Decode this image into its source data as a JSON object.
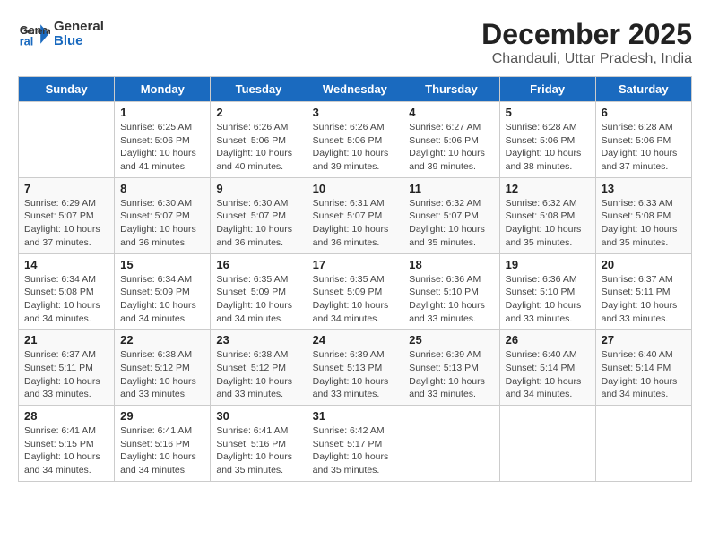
{
  "header": {
    "logo_line1": "General",
    "logo_line2": "Blue",
    "title": "December 2025",
    "subtitle": "Chandauli, Uttar Pradesh, India"
  },
  "columns": [
    "Sunday",
    "Monday",
    "Tuesday",
    "Wednesday",
    "Thursday",
    "Friday",
    "Saturday"
  ],
  "weeks": [
    [
      {
        "day": "",
        "info": ""
      },
      {
        "day": "1",
        "info": "Sunrise: 6:25 AM\nSunset: 5:06 PM\nDaylight: 10 hours\nand 41 minutes."
      },
      {
        "day": "2",
        "info": "Sunrise: 6:26 AM\nSunset: 5:06 PM\nDaylight: 10 hours\nand 40 minutes."
      },
      {
        "day": "3",
        "info": "Sunrise: 6:26 AM\nSunset: 5:06 PM\nDaylight: 10 hours\nand 39 minutes."
      },
      {
        "day": "4",
        "info": "Sunrise: 6:27 AM\nSunset: 5:06 PM\nDaylight: 10 hours\nand 39 minutes."
      },
      {
        "day": "5",
        "info": "Sunrise: 6:28 AM\nSunset: 5:06 PM\nDaylight: 10 hours\nand 38 minutes."
      },
      {
        "day": "6",
        "info": "Sunrise: 6:28 AM\nSunset: 5:06 PM\nDaylight: 10 hours\nand 37 minutes."
      }
    ],
    [
      {
        "day": "7",
        "info": "Sunrise: 6:29 AM\nSunset: 5:07 PM\nDaylight: 10 hours\nand 37 minutes."
      },
      {
        "day": "8",
        "info": "Sunrise: 6:30 AM\nSunset: 5:07 PM\nDaylight: 10 hours\nand 36 minutes."
      },
      {
        "day": "9",
        "info": "Sunrise: 6:30 AM\nSunset: 5:07 PM\nDaylight: 10 hours\nand 36 minutes."
      },
      {
        "day": "10",
        "info": "Sunrise: 6:31 AM\nSunset: 5:07 PM\nDaylight: 10 hours\nand 36 minutes."
      },
      {
        "day": "11",
        "info": "Sunrise: 6:32 AM\nSunset: 5:07 PM\nDaylight: 10 hours\nand 35 minutes."
      },
      {
        "day": "12",
        "info": "Sunrise: 6:32 AM\nSunset: 5:08 PM\nDaylight: 10 hours\nand 35 minutes."
      },
      {
        "day": "13",
        "info": "Sunrise: 6:33 AM\nSunset: 5:08 PM\nDaylight: 10 hours\nand 35 minutes."
      }
    ],
    [
      {
        "day": "14",
        "info": "Sunrise: 6:34 AM\nSunset: 5:08 PM\nDaylight: 10 hours\nand 34 minutes."
      },
      {
        "day": "15",
        "info": "Sunrise: 6:34 AM\nSunset: 5:09 PM\nDaylight: 10 hours\nand 34 minutes."
      },
      {
        "day": "16",
        "info": "Sunrise: 6:35 AM\nSunset: 5:09 PM\nDaylight: 10 hours\nand 34 minutes."
      },
      {
        "day": "17",
        "info": "Sunrise: 6:35 AM\nSunset: 5:09 PM\nDaylight: 10 hours\nand 34 minutes."
      },
      {
        "day": "18",
        "info": "Sunrise: 6:36 AM\nSunset: 5:10 PM\nDaylight: 10 hours\nand 33 minutes."
      },
      {
        "day": "19",
        "info": "Sunrise: 6:36 AM\nSunset: 5:10 PM\nDaylight: 10 hours\nand 33 minutes."
      },
      {
        "day": "20",
        "info": "Sunrise: 6:37 AM\nSunset: 5:11 PM\nDaylight: 10 hours\nand 33 minutes."
      }
    ],
    [
      {
        "day": "21",
        "info": "Sunrise: 6:37 AM\nSunset: 5:11 PM\nDaylight: 10 hours\nand 33 minutes."
      },
      {
        "day": "22",
        "info": "Sunrise: 6:38 AM\nSunset: 5:12 PM\nDaylight: 10 hours\nand 33 minutes."
      },
      {
        "day": "23",
        "info": "Sunrise: 6:38 AM\nSunset: 5:12 PM\nDaylight: 10 hours\nand 33 minutes."
      },
      {
        "day": "24",
        "info": "Sunrise: 6:39 AM\nSunset: 5:13 PM\nDaylight: 10 hours\nand 33 minutes."
      },
      {
        "day": "25",
        "info": "Sunrise: 6:39 AM\nSunset: 5:13 PM\nDaylight: 10 hours\nand 33 minutes."
      },
      {
        "day": "26",
        "info": "Sunrise: 6:40 AM\nSunset: 5:14 PM\nDaylight: 10 hours\nand 34 minutes."
      },
      {
        "day": "27",
        "info": "Sunrise: 6:40 AM\nSunset: 5:14 PM\nDaylight: 10 hours\nand 34 minutes."
      }
    ],
    [
      {
        "day": "28",
        "info": "Sunrise: 6:41 AM\nSunset: 5:15 PM\nDaylight: 10 hours\nand 34 minutes."
      },
      {
        "day": "29",
        "info": "Sunrise: 6:41 AM\nSunset: 5:16 PM\nDaylight: 10 hours\nand 34 minutes."
      },
      {
        "day": "30",
        "info": "Sunrise: 6:41 AM\nSunset: 5:16 PM\nDaylight: 10 hours\nand 35 minutes."
      },
      {
        "day": "31",
        "info": "Sunrise: 6:42 AM\nSunset: 5:17 PM\nDaylight: 10 hours\nand 35 minutes."
      },
      {
        "day": "",
        "info": ""
      },
      {
        "day": "",
        "info": ""
      },
      {
        "day": "",
        "info": ""
      }
    ]
  ]
}
